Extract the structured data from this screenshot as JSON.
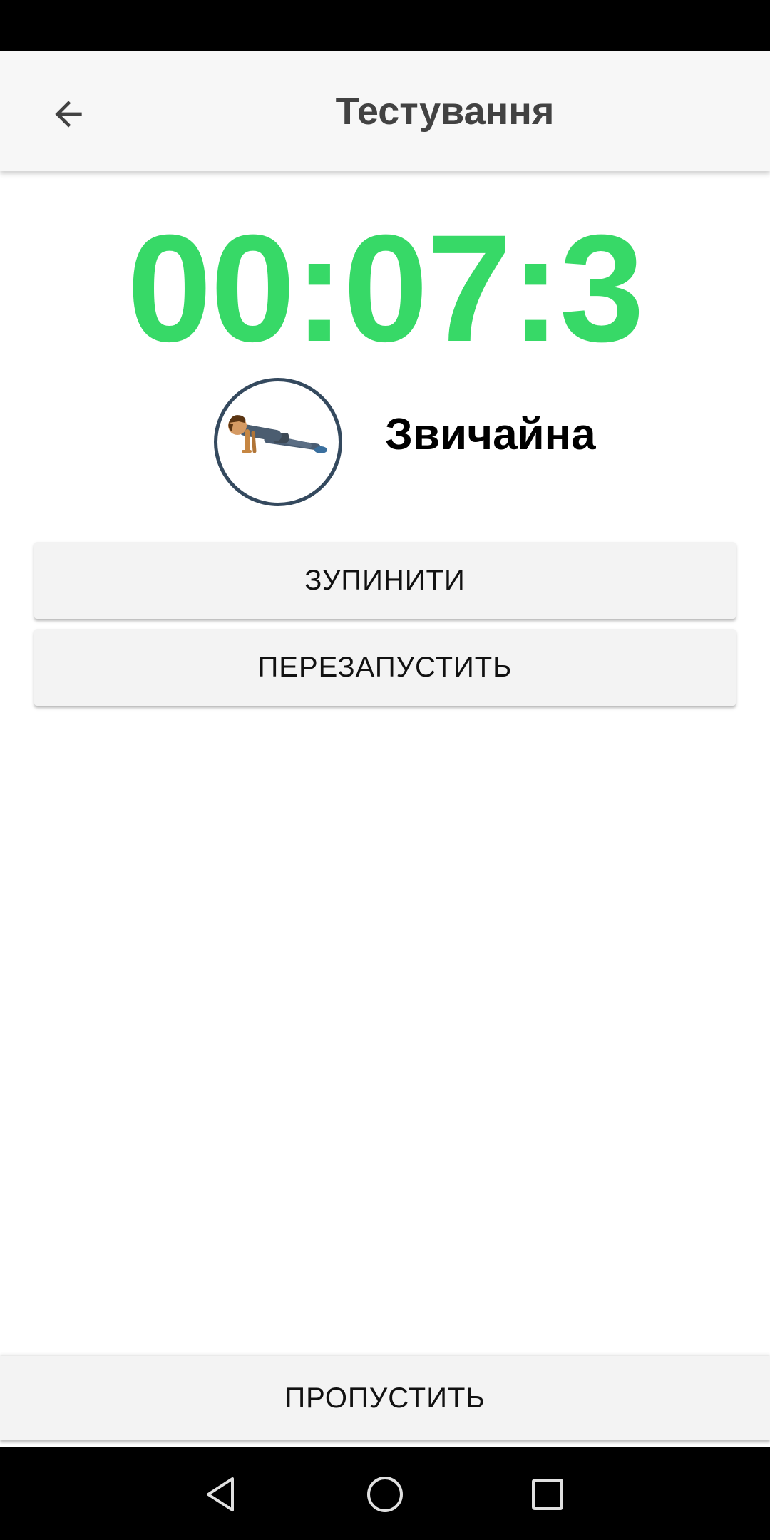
{
  "app_bar": {
    "title": "Тестування",
    "back_icon": "arrow-left-icon"
  },
  "timer": {
    "value": "00:07:3",
    "color": "#37d967"
  },
  "exercise": {
    "name": "Звичайна",
    "image_icon": "pushup-figure-icon"
  },
  "buttons": {
    "stop_label": "ЗУПИНИТИ",
    "restart_label": "ПЕРЕЗАПУСТИТЬ",
    "skip_label": "ПРОПУСТИТЬ"
  },
  "nav_bar": {
    "back_icon": "triangle-back-icon",
    "home_icon": "circle-home-icon",
    "recents_icon": "square-recents-icon"
  }
}
